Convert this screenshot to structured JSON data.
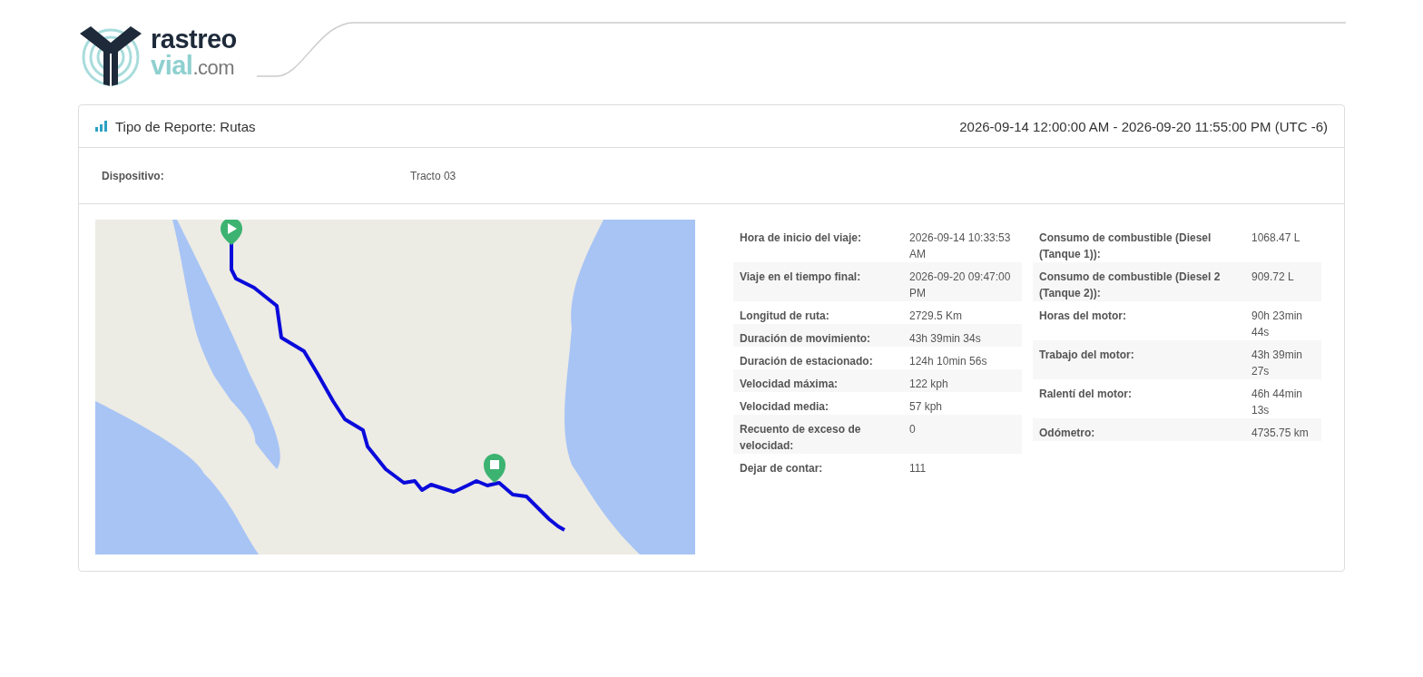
{
  "logo": {
    "word_top": "rastreo",
    "word_bottom": "vial",
    "suffix": ".com"
  },
  "report": {
    "title": "Tipo de Reporte: Rutas",
    "period": "2026-09-14 12:00:00 AM - 2026-09-20 11:55:00 PM (UTC -6)"
  },
  "device": {
    "label": "Dispositivo:",
    "value": "Tracto 03"
  },
  "trip_table": [
    {
      "label": "Hora de inicio del viaje:",
      "value": "2026-09-14 10:33:53 AM"
    },
    {
      "label": "Viaje en el tiempo final:",
      "value": "2026-09-20 09:47:00 PM"
    },
    {
      "label": "Longitud de ruta:",
      "value": "2729.5 Km"
    },
    {
      "label": "Duración de movimiento:",
      "value": "43h 39min 34s"
    },
    {
      "label": "Duración de estacionado:",
      "value": "124h 10min 56s"
    },
    {
      "label": "Velocidad máxima:",
      "value": "122 kph"
    },
    {
      "label": "Velocidad media:",
      "value": "57 kph"
    },
    {
      "label": "Recuento de exceso de velocidad:",
      "value": "0"
    },
    {
      "label": "Dejar de contar:",
      "value": "111"
    }
  ],
  "engine_table": [
    {
      "label": "Consumo de combustible (Diesel (Tanque 1)):",
      "value": "1068.47 L"
    },
    {
      "label": "Consumo de combustible (Diesel 2 (Tanque 2)):",
      "value": "909.72 L"
    },
    {
      "label": "Horas del motor:",
      "value": "90h 23min 44s"
    },
    {
      "label": "Trabajo del motor:",
      "value": "43h 39min 27s"
    },
    {
      "label": "Ralentí del motor:",
      "value": "46h 44min 13s"
    },
    {
      "label": "Odómetro:",
      "value": "4735.75 km"
    }
  ]
}
